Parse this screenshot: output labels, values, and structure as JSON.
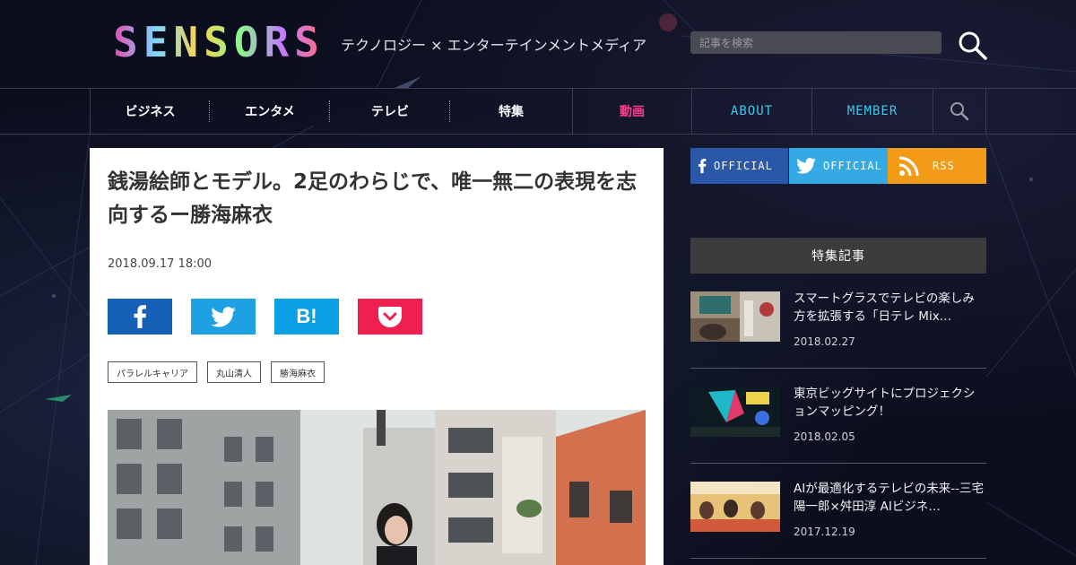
{
  "header": {
    "logo_text": "SENSORS",
    "tagline": "テクノロジー × エンターテインメントメディア",
    "search_placeholder": "記事を検索"
  },
  "nav": {
    "items": [
      {
        "label": "ビジネス"
      },
      {
        "label": "エンタメ"
      },
      {
        "label": "テレビ"
      },
      {
        "label": "特集"
      },
      {
        "label": "動画"
      },
      {
        "label": "ABOUT"
      },
      {
        "label": "MEMBER"
      }
    ]
  },
  "article": {
    "title": "銭湯絵師とモデル。2足のわらじで、唯一無二の表現を志向するー勝海麻衣",
    "date": "2018.09.17 18:00",
    "share": {
      "hatena_label": "B!"
    },
    "tags": [
      "パラレルキャリア",
      "丸山清人",
      "勝海麻衣"
    ]
  },
  "sidebar": {
    "social": [
      {
        "label": "OFFICIAL",
        "icon": "facebook-icon",
        "color": "#2a57a8"
      },
      {
        "label": "OFFICIAL",
        "icon": "twitter-icon",
        "color": "#34a9e3"
      },
      {
        "label": "RSS",
        "icon": "rss-icon",
        "color": "#f39a17"
      }
    ],
    "feature_header": "特集記事",
    "articles": [
      {
        "title": "スマートグラスでテレビの楽しみ方を拡張する「日テレ Mix…",
        "date": "2018.02.27"
      },
      {
        "title": "東京ビッグサイトにプロジェクションマッピング！",
        "date": "2018.02.05"
      },
      {
        "title": "AIが最適化するテレビの未来--三宅陽一郎×舛田淳 AIビジネ…",
        "date": "2017.12.19"
      }
    ]
  },
  "colors": {
    "nav_accent": "#ff3d8c",
    "nav_cyan": "#3fc8e8",
    "facebook": "#1760b8",
    "twitter": "#1da1e2",
    "hatena": "#0aa0e3",
    "pocket": "#ef2050"
  }
}
